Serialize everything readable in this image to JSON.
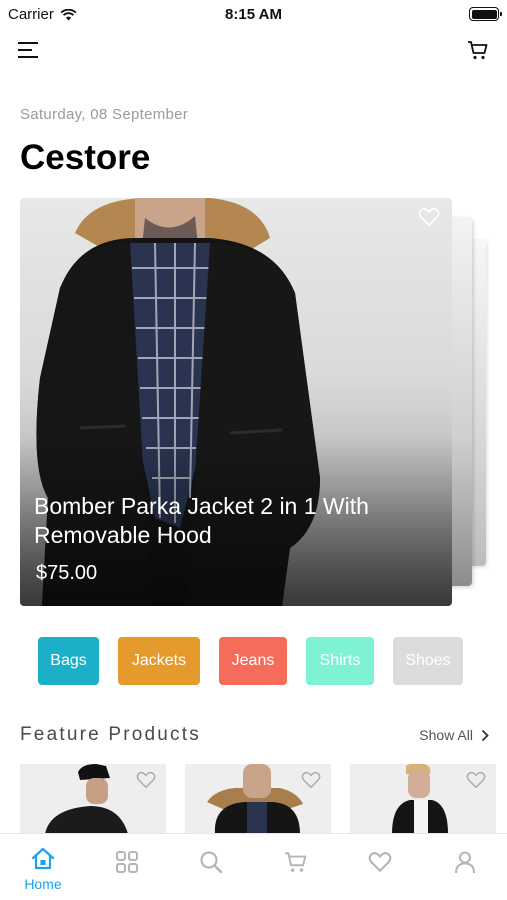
{
  "status_bar": {
    "carrier": "Carrier",
    "time": "8:15 AM"
  },
  "header": {
    "date": "Saturday, 08 September",
    "title": "Cestore"
  },
  "hero": {
    "product_title": "Bomber Parka Jacket 2 in 1 With Removable Hood",
    "price": "$75.00"
  },
  "categories": [
    {
      "label": "Bags",
      "color": "#1bb0c8"
    },
    {
      "label": "Jackets",
      "color": "#e49a2c"
    },
    {
      "label": "Jeans",
      "color": "#f56d5a"
    },
    {
      "label": "Shirts",
      "color": "#7ef2d5"
    },
    {
      "label": "Shoes",
      "color": "#dcdcdc"
    }
  ],
  "featured": {
    "title": "Feature Products",
    "show_all": "Show All"
  },
  "tabbar": {
    "active": "Home",
    "items": [
      {
        "icon": "home-icon",
        "label": "Home"
      },
      {
        "icon": "grid-icon"
      },
      {
        "icon": "search-icon"
      },
      {
        "icon": "cart-icon"
      },
      {
        "icon": "heart-icon"
      },
      {
        "icon": "profile-icon"
      }
    ]
  },
  "colors": {
    "accent": "#1aa3e8",
    "icon_inactive": "#b5b5b5"
  }
}
